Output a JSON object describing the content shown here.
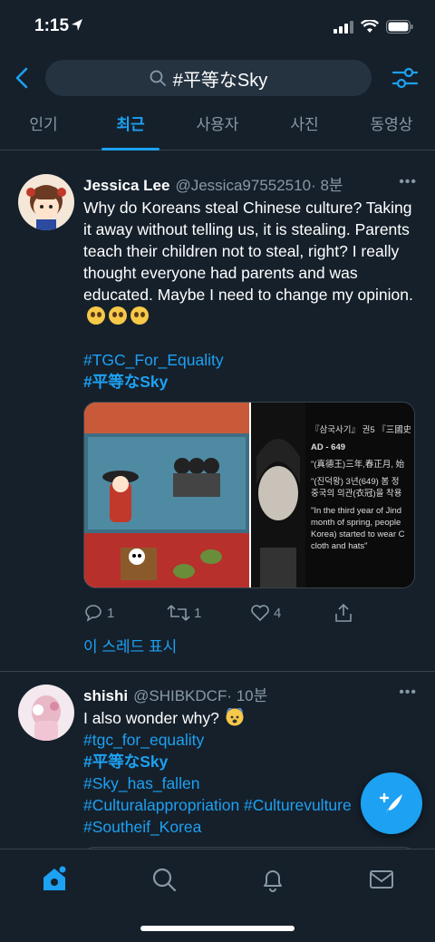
{
  "status": {
    "time": "1:15"
  },
  "search": {
    "query": "#平等なSky"
  },
  "tabs": [
    {
      "label": "인기",
      "active": false
    },
    {
      "label": "최근",
      "active": true
    },
    {
      "label": "사용자",
      "active": false
    },
    {
      "label": "사진",
      "active": false
    },
    {
      "label": "동영상",
      "active": false
    }
  ],
  "tweets": [
    {
      "name": "Jessica Lee",
      "handle": "@Jessica97552510",
      "time": "· 8분",
      "text": "Why do Koreans steal Chinese culture? Taking it away without telling us, it is stealing. Parents teach their children not to steal,  right?  I really thought everyone had parents and was educated. Maybe I need to change my opinion.",
      "tags": [
        "#TGC_For_Equality",
        "#平等なSky"
      ],
      "media_right": {
        "line1": "『삼국사기』 권5 『三國史",
        "line2": "AD - 649",
        "line3": "\"(真德王)三年,春正月, 始",
        "line4": "\"(진덕왕) 3년(649) 봄 정",
        "line5": "중국의 의관(衣冠)을 착용",
        "line6": "\"In the third year of Jind",
        "line7": "month of spring, people",
        "line8": "Korea) started to wear C",
        "line9": "cloth and hats\""
      },
      "replies": "1",
      "retweets": "1",
      "likes": "4",
      "thread_label": "이 스레드 표시"
    },
    {
      "name": "shishi",
      "handle": "@SHIBKDCF",
      "time": "· 10분",
      "text": "I also wonder why?",
      "tags": [
        "#tgc_for_equality",
        "#平等なSky",
        "#Sky_has_fallen",
        "#Culturalappropriation #Culturevulture",
        "#Southeif_Korea"
      ]
    }
  ],
  "colors": {
    "accent": "#1da1f2",
    "background": "#15202b",
    "muted": "#8899a6"
  }
}
